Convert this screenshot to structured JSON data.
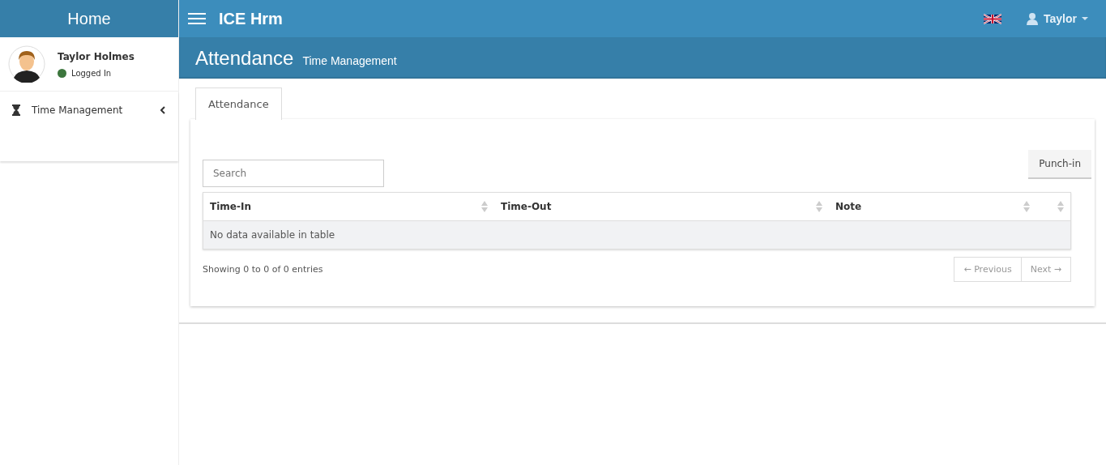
{
  "sidebar": {
    "brand": "Home",
    "user": {
      "name": "Taylor Holmes",
      "status": "Logged In"
    },
    "menu": [
      {
        "label": "Time Management"
      }
    ]
  },
  "topbar": {
    "app_name": "ICE Hrm",
    "user_menu": "Taylor"
  },
  "page_header": {
    "title": "Attendance",
    "subtitle": "Time Management"
  },
  "tabs": [
    {
      "label": "Attendance",
      "selected": true
    }
  ],
  "search": {
    "placeholder": "Search"
  },
  "punch_button": "Punch-in",
  "table": {
    "columns": [
      "Time-In",
      "Time-Out",
      "Note",
      ""
    ],
    "empty_message": "No data available in table"
  },
  "info": "Showing 0 to 0 of 0 entries",
  "pagination": [
    {
      "label": "← Previous",
      "disabled": true
    },
    {
      "label": "Next →",
      "disabled": true
    }
  ]
}
